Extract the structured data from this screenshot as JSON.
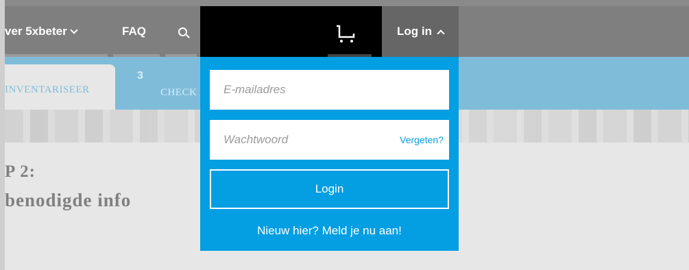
{
  "nav": {
    "over_label": "ver 5xbeter",
    "faq_label": "FAQ",
    "login_label": "Log in"
  },
  "steps": {
    "active_label": "INVENTARISEER",
    "next_number": "3",
    "next_label": "CHECK"
  },
  "heading": {
    "step": "P 2:",
    "subtitle": "benodigde info"
  },
  "login": {
    "email_placeholder": "E-mailadres",
    "password_placeholder": "Wachtwoord",
    "forgot_label": "Vergeten?",
    "submit_label": "Login",
    "register_label": "Nieuw hier? Meld je nu aan!"
  },
  "colors": {
    "accent": "#049ee2",
    "step_bar": "#7fbcd9",
    "nav_bg": "#7f7f7f"
  },
  "icons": [
    "chevron-down-icon",
    "search-icon",
    "cart-icon",
    "chevron-up-icon"
  ]
}
